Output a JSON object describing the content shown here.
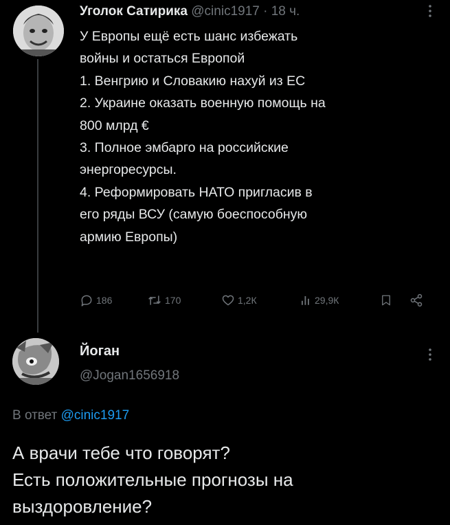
{
  "tweet1": {
    "author_name": "Уголок Сатирика",
    "handle": "@cinic1917",
    "separator": "·",
    "time": "18 ч.",
    "lines": [
      "У Европы ещё есть шанс избежать",
      "войны и остаться Европой",
      "1. Венгрию и Словакию нахуй из ЕС",
      "2. Украине оказать военную помощь на",
      "800 млрд €",
      "3. Полное эмбарго на российские",
      "энергоресурсы.",
      "4. Реформировать НАТО пригласив в",
      "его ряды ВСУ (самую боеспособную",
      "армию Европы)"
    ],
    "actions": {
      "replies": "186",
      "retweets": "170",
      "likes": "1,2К",
      "views": "29,9К"
    },
    "icons": [
      "more-icon",
      "reply-icon",
      "retweet-icon",
      "like-icon",
      "views-icon",
      "bookmark-icon",
      "share-icon"
    ]
  },
  "tweet2": {
    "author_name": "Йоган",
    "handle": "@Jogan1656918",
    "reply_prefix": "В ответ",
    "reply_handle": "@cinic1917",
    "lines": [
      "А врачи тебе что говорят?",
      "Есть положительные прогнозы на",
      "выздоровление?"
    ]
  },
  "colors": {
    "background": "#000000",
    "text": "#e7e9ea",
    "muted": "#71767b",
    "link": "#1d9bf0",
    "thread_line": "#3a3d40"
  }
}
